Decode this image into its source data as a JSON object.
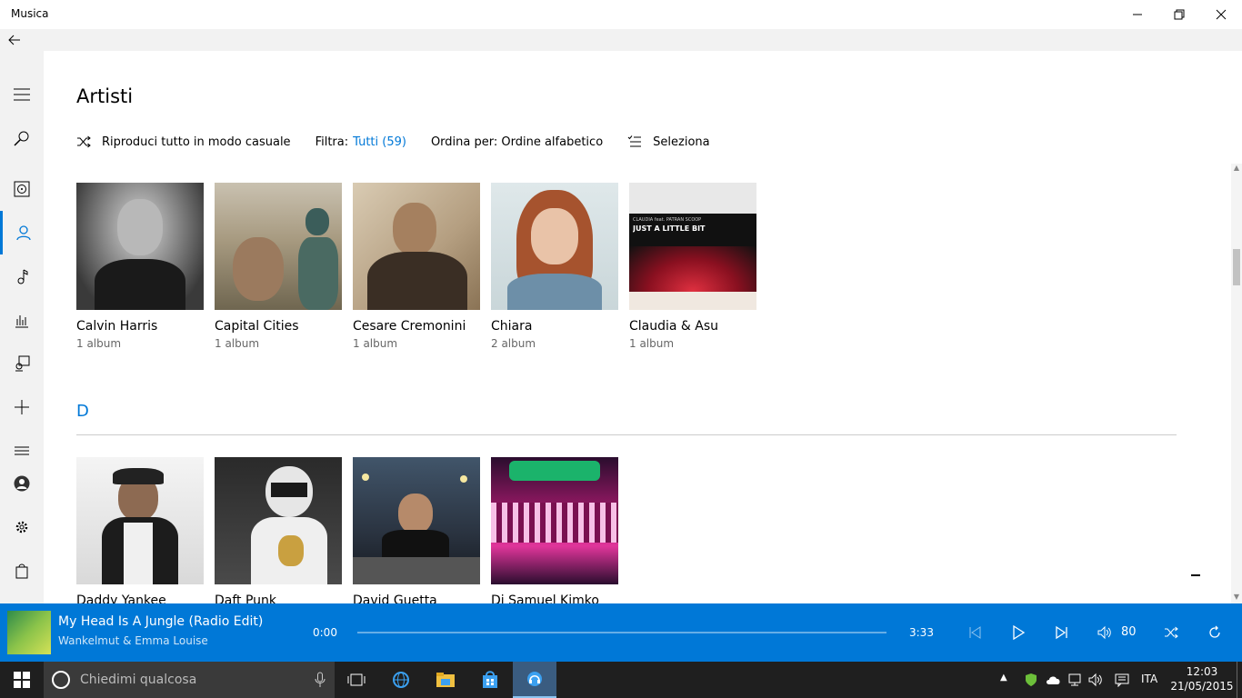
{
  "window": {
    "title": "Musica"
  },
  "page": {
    "title": "Artisti",
    "commands": {
      "shuffle": "Riproduci tutto in modo casuale",
      "filter_label": "Filtra:",
      "filter_value": "Tutti (59)",
      "sort": "Ordina per: Ordine alfabetico",
      "select": "Seleziona"
    },
    "section_c": [
      {
        "name": "Calvin Harris",
        "albums": "1 album"
      },
      {
        "name": "Capital Cities",
        "albums": "1 album"
      },
      {
        "name": "Cesare Cremonini",
        "albums": "1 album"
      },
      {
        "name": "Chiara",
        "albums": "2 album"
      },
      {
        "name": "Claudia & Asu",
        "albums": "1 album"
      }
    ],
    "section_d_letter": "D",
    "section_d": [
      {
        "name": "Daddy Yankee"
      },
      {
        "name": "Daft Punk"
      },
      {
        "name": "David Guetta"
      },
      {
        "name": "Dj Samuel Kimko"
      }
    ],
    "album_art_text": {
      "line1": "CLAUDIA feat. PATRAN SCOOP",
      "line2": "JUST A LITTLE BIT"
    }
  },
  "player": {
    "track": "My Head Is A Jungle (Radio Edit)",
    "artist": "Wankelmut & Emma Louise",
    "elapsed": "0:00",
    "duration": "3:33",
    "progress": 0,
    "volume": "80"
  },
  "taskbar": {
    "search_placeholder": "Chiedimi qualcosa",
    "language": "ITA",
    "time": "12:03",
    "date": "21/05/2015"
  },
  "colors": {
    "accent": "#0078d7",
    "taskbar": "#1f1f1f"
  }
}
